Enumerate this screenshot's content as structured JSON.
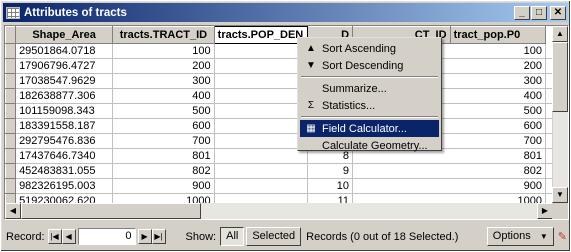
{
  "window": {
    "title": "Attributes of tracts"
  },
  "table": {
    "columns": [
      "Shape_Area",
      "tracts.TRACT_ID",
      "tracts.POP_DEN",
      "Pop_ID",
      "tract_pop.TRACT_ID",
      "tract_pop.P0"
    ],
    "headers_visible": [
      "Shape_Area",
      "tracts.TRACT_ID",
      "tracts.POP_DEN",
      "D",
      "",
      "CT_ID",
      "tract_pop.P0"
    ],
    "rows": [
      [
        "29501864.0718",
        "100",
        "",
        "1",
        "100"
      ],
      [
        "17906796.4727",
        "200",
        "",
        "2",
        "200"
      ],
      [
        "17038547.9629",
        "300",
        "",
        "3",
        "300"
      ],
      [
        "182638877.306",
        "400",
        "",
        "4",
        "400"
      ],
      [
        "101159098.343",
        "500",
        "",
        "5",
        "500"
      ],
      [
        "183391558.187",
        "600",
        "",
        "6",
        "600"
      ],
      [
        "292795476.836",
        "700",
        "",
        "7",
        "700"
      ],
      [
        "17437646.7340",
        "801",
        "",
        "8",
        "801"
      ],
      [
        "452483831.055",
        "802",
        "",
        "9",
        "802"
      ],
      [
        "982326195.003",
        "900",
        "",
        "10",
        "900"
      ],
      [
        "519230062.620",
        "1000",
        "",
        "11",
        "1000"
      ]
    ]
  },
  "context_menu": {
    "items": [
      {
        "label": "Sort Ascending",
        "icon": "sort-ascending-icon",
        "glyph": "▲"
      },
      {
        "label": "Sort Descending",
        "icon": "sort-descending-icon",
        "glyph": "▼"
      },
      {
        "label": "Summarize...",
        "icon": "",
        "glyph": ""
      },
      {
        "label": "Statistics...",
        "icon": "sigma-icon",
        "glyph": "Σ"
      },
      {
        "label": "Field Calculator...",
        "icon": "calculator-icon",
        "glyph": "▦"
      },
      {
        "label": "Calculate Geometry...",
        "icon": "",
        "glyph": ""
      }
    ],
    "highlighted": "Field Calculator..."
  },
  "status": {
    "record_label": "Record:",
    "record_value": "0",
    "show_label": "Show:",
    "all_label": "All",
    "selected_label": "Selected",
    "records_text": "Records (0 out of 18 Selected.)",
    "options_label": "Options"
  },
  "colors": {
    "title_start": "#0a246a",
    "title_end": "#a6caf0",
    "highlight": "#0a246a",
    "chrome": "#d4d0c8"
  }
}
